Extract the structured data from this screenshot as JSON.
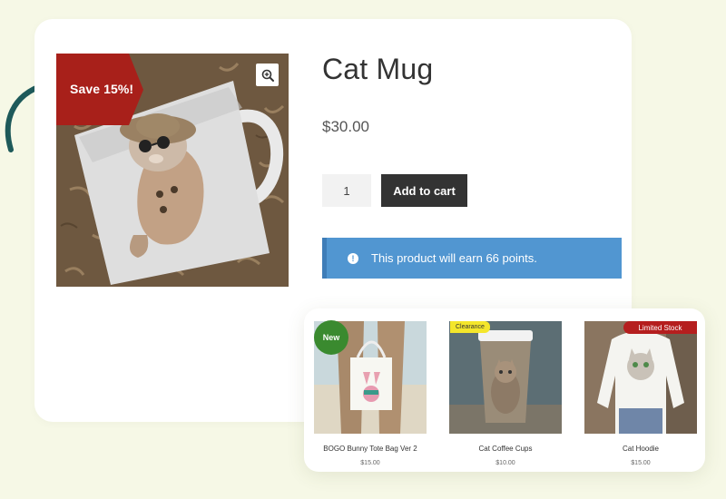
{
  "product": {
    "title": "Cat Mug",
    "price": "$30.00",
    "quantity": "1",
    "add_to_cart_label": "Add to cart",
    "sale_badge": "Save 15%!",
    "points_notice": "This product will earn 66 points.",
    "notice_icon": "!"
  },
  "related": {
    "items": [
      {
        "name": "BOGO Bunny Tote Bag Ver 2",
        "price": "$15.00",
        "badge": "New"
      },
      {
        "name": "Cat Coffee Cups",
        "price": "$10.00",
        "badge": "Clearance"
      },
      {
        "name": "Cat Hoodie",
        "price": "$15.00",
        "badge": "Limited Stock"
      }
    ]
  },
  "icons": {
    "zoom": "magnifier-plus-icon",
    "arrow": "curved-arrow-icon",
    "info": "info-icon"
  },
  "colors": {
    "background": "#f6f8e6",
    "sale_badge": "#a8201a",
    "arrow": "#1e5a5a",
    "notice": "#5196d1",
    "button": "#333333",
    "badge_new": "#3a8a2f",
    "badge_clearance": "#f4e62b",
    "badge_limited": "#b51e1e"
  }
}
